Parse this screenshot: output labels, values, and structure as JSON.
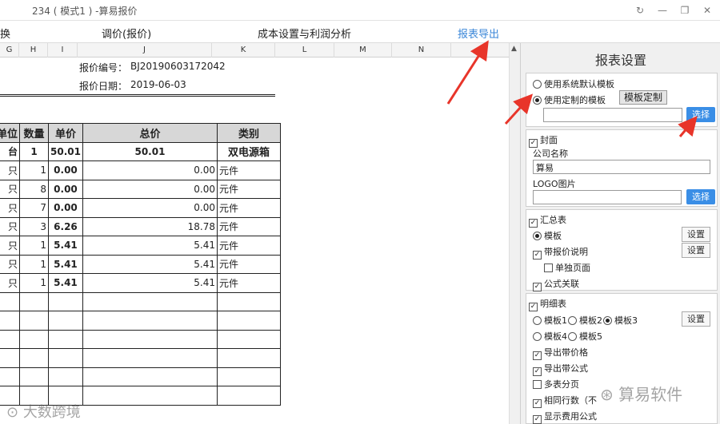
{
  "window": {
    "title": "234 ( 模式1 ) -算易报价",
    "controls": [
      "↻",
      "—",
      "❐",
      "✕"
    ]
  },
  "menu": {
    "item_switch": "换",
    "item_price": "调价(报价)",
    "item_cost": "成本设置与利润分析",
    "item_export": "报表导出"
  },
  "columns": [
    "G",
    "H",
    "I",
    "J",
    "K",
    "L",
    "M",
    "N"
  ],
  "quote": {
    "number_label": "报价编号：",
    "number_value": "BJ20190603172042",
    "date_label": "报价日期：",
    "date_value": "2019-06-03"
  },
  "table": {
    "headers": [
      "单位",
      "数量",
      "单价",
      "总价",
      "类别"
    ],
    "rows": [
      [
        "台",
        "1",
        "50.01",
        "50.01",
        "双电源箱"
      ],
      [
        "只",
        "1",
        "0.00",
        "0.00",
        "元件"
      ],
      [
        "只",
        "8",
        "0.00",
        "0.00",
        "元件"
      ],
      [
        "只",
        "7",
        "0.00",
        "0.00",
        "元件"
      ],
      [
        "只",
        "3",
        "6.26",
        "18.78",
        "元件"
      ],
      [
        "只",
        "1",
        "5.41",
        "5.41",
        "元件"
      ],
      [
        "只",
        "1",
        "5.41",
        "5.41",
        "元件"
      ],
      [
        "只",
        "1",
        "5.41",
        "5.41",
        "元件"
      ]
    ]
  },
  "panel": {
    "title": "报表设置",
    "use_default": "使用系统默认模板",
    "use_custom": "使用定制的模板",
    "template_custom_btn": "模板定制",
    "select_btn": "选择",
    "cover": "封面",
    "company_label": "公司名称",
    "company_value": "算易",
    "logo_label": "LOGO图片",
    "summary": "汇总表",
    "template": "模板",
    "settings_btn": "设置",
    "with_desc": "带报价说明",
    "single_page": "单独页面",
    "formula_link": "公式关联",
    "detail": "明细表",
    "t1": "模板1",
    "t2": "模板2",
    "t3": "模板3",
    "t4": "模板4",
    "t5": "模板5",
    "export_price": "导出带价格",
    "export_formula": "导出带公式",
    "multi_sheet": "多表分页",
    "same_rows": "相同行数（不",
    "show_fee_formula": "显示费用公式"
  },
  "watermarks": {
    "left": "大数跨境",
    "right": "算易软件"
  },
  "colors": {
    "accent": "#3a8ee6",
    "arrow": "#e8352a",
    "header_bg": "#d7d7d7"
  }
}
